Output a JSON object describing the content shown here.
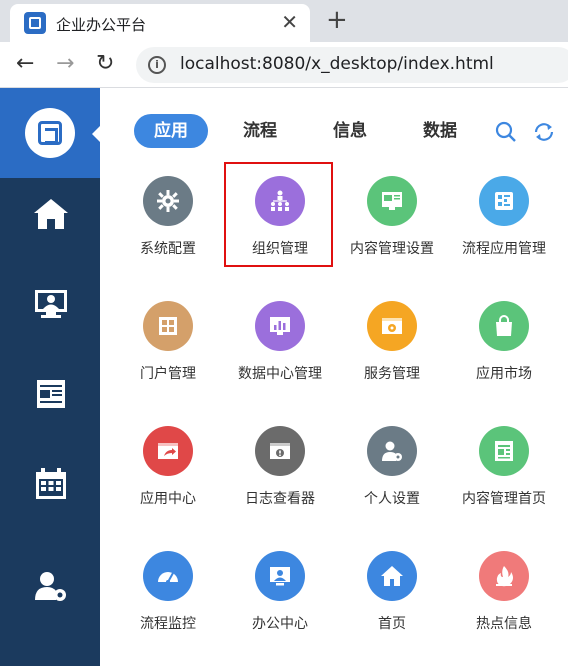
{
  "browser": {
    "tab_title": "企业办公平台",
    "tab_close": "✕",
    "new_tab": "+",
    "back": "←",
    "forward": "→",
    "reload": "↻",
    "url": "localhost:8080/x_desktop/index.html"
  },
  "sidebar": {
    "items": [
      {
        "name": "home-icon"
      },
      {
        "name": "office-desk-icon"
      },
      {
        "name": "news-icon"
      },
      {
        "name": "calendar-icon"
      },
      {
        "name": "user-settings-icon"
      }
    ]
  },
  "tabs": [
    {
      "label": "应用",
      "active": true
    },
    {
      "label": "流程",
      "active": false
    },
    {
      "label": "信息",
      "active": false
    },
    {
      "label": "数据",
      "active": false
    }
  ],
  "apps": [
    {
      "label": "系统配置",
      "color": "#6b7b86",
      "icon": "gear-icon"
    },
    {
      "label": "组织管理",
      "color": "#9b6fdc",
      "icon": "org-chart-icon"
    },
    {
      "label": "内容管理设置",
      "color": "#5bc47a",
      "icon": "content-settings-icon"
    },
    {
      "label": "流程应用管理",
      "color": "#4aa9e8",
      "icon": "process-app-icon"
    },
    {
      "label": "门户管理",
      "color": "#d4a06a",
      "icon": "portal-icon"
    },
    {
      "label": "数据中心管理",
      "color": "#9b6fdc",
      "icon": "data-center-icon"
    },
    {
      "label": "服务管理",
      "color": "#f5a623",
      "icon": "service-icon"
    },
    {
      "label": "应用市场",
      "color": "#5bc47a",
      "icon": "shopping-bag-icon"
    },
    {
      "label": "应用中心",
      "color": "#e04848",
      "icon": "app-center-icon"
    },
    {
      "label": "日志查看器",
      "color": "#6b6b6b",
      "icon": "log-viewer-icon"
    },
    {
      "label": "个人设置",
      "color": "#6b7b86",
      "icon": "personal-settings-icon"
    },
    {
      "label": "内容管理首页",
      "color": "#5bc47a",
      "icon": "content-home-icon"
    },
    {
      "label": "流程监控",
      "color": "#3d87e0",
      "icon": "gauge-icon"
    },
    {
      "label": "办公中心",
      "color": "#3d87e0",
      "icon": "office-center-icon"
    },
    {
      "label": "首页",
      "color": "#3d87e0",
      "icon": "home-icon"
    },
    {
      "label": "热点信息",
      "color": "#f07a7a",
      "icon": "hot-icon"
    }
  ]
}
